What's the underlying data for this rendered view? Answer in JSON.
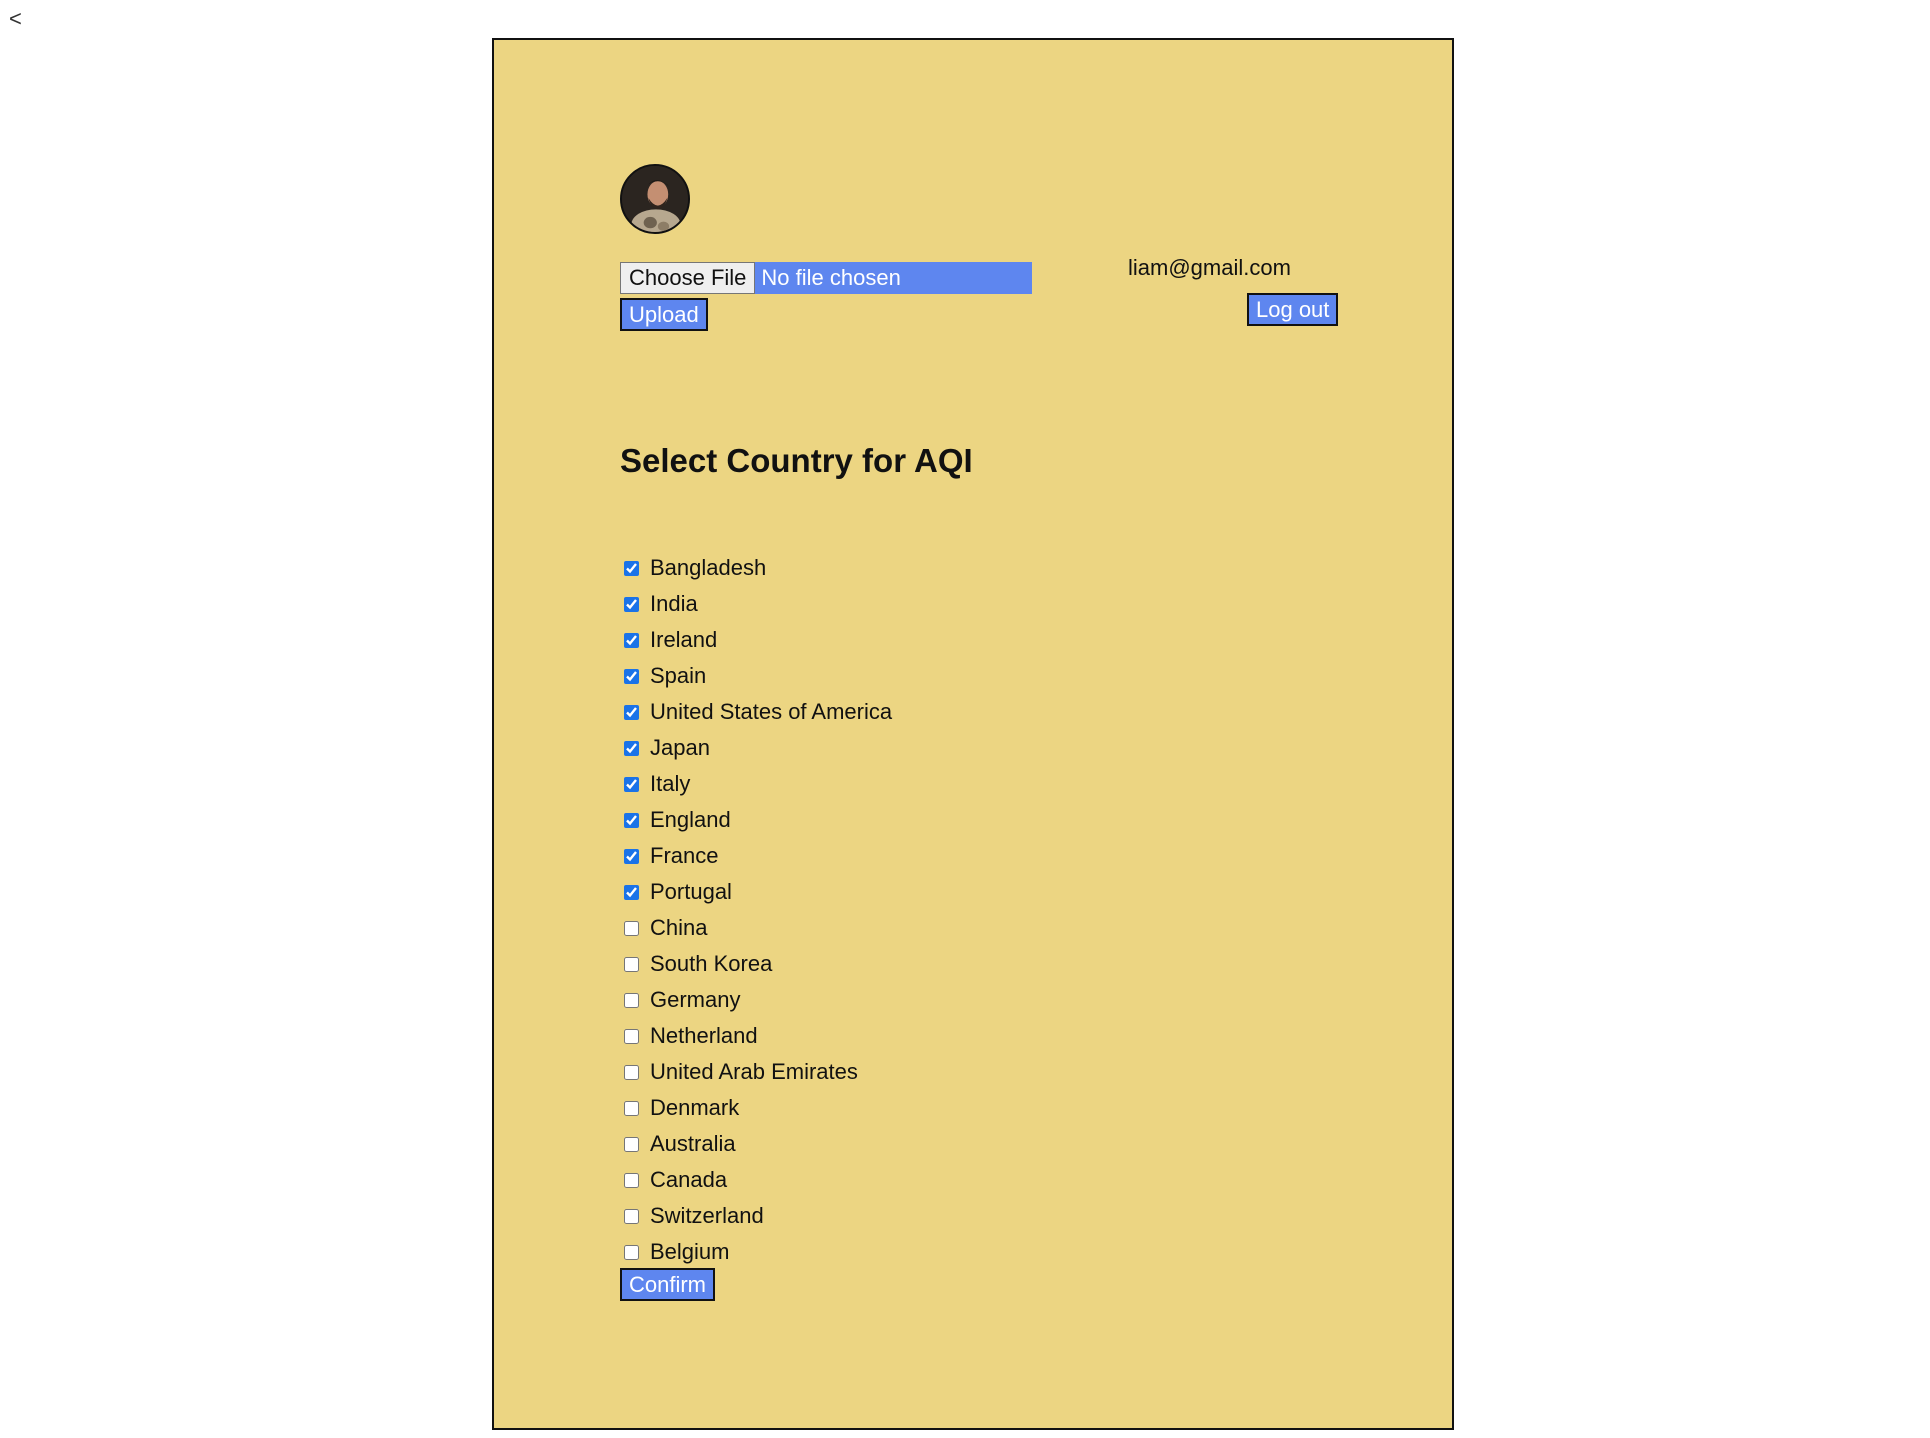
{
  "nav": {
    "back_label": "<"
  },
  "profile": {
    "email": "liam@gmail.com",
    "logout_label": "Log out"
  },
  "upload": {
    "choose_label": "Choose File",
    "status": "No file chosen",
    "upload_label": "Upload"
  },
  "form": {
    "title": "Select Country for AQI",
    "confirm_label": "Confirm",
    "countries": [
      {
        "label": "Bangladesh",
        "checked": true
      },
      {
        "label": "India",
        "checked": true
      },
      {
        "label": "Ireland",
        "checked": true
      },
      {
        "label": "Spain",
        "checked": true
      },
      {
        "label": "United States of America",
        "checked": true
      },
      {
        "label": "Japan",
        "checked": true
      },
      {
        "label": "Italy",
        "checked": true
      },
      {
        "label": "England",
        "checked": true
      },
      {
        "label": "France",
        "checked": true
      },
      {
        "label": "Portugal",
        "checked": true
      },
      {
        "label": "China",
        "checked": false
      },
      {
        "label": "South Korea",
        "checked": false
      },
      {
        "label": "Germany",
        "checked": false
      },
      {
        "label": "Netherland",
        "checked": false
      },
      {
        "label": "United Arab Emirates",
        "checked": false
      },
      {
        "label": "Denmark",
        "checked": false
      },
      {
        "label": "Australia",
        "checked": false
      },
      {
        "label": "Canada",
        "checked": false
      },
      {
        "label": "Switzerland",
        "checked": false
      },
      {
        "label": "Belgium",
        "checked": false
      }
    ]
  },
  "colors": {
    "panel_background": "#ecd582",
    "button_accent": "#5e86ef",
    "checkbox_accent": "#1a73e8"
  },
  "icons": {
    "avatar": "user-avatar-photo"
  }
}
